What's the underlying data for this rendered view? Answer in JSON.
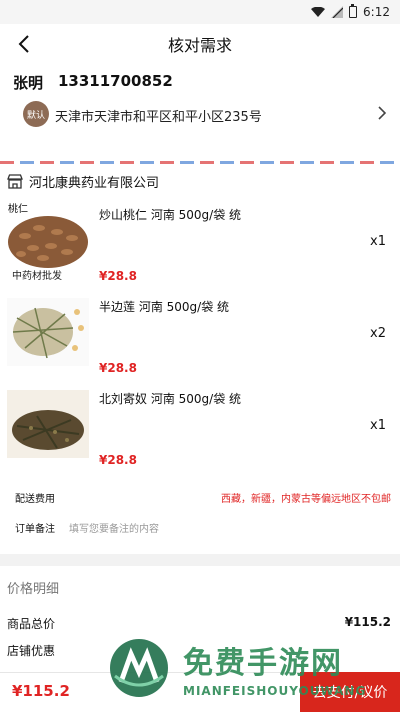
{
  "status_bar": {
    "time": "6:12"
  },
  "nav": {
    "title": "核对需求"
  },
  "address": {
    "name": "张明",
    "phone": "13311700852",
    "badge": "默认",
    "text": "天津市天津市和平区和平小区235号"
  },
  "store": {
    "name": "河北康典药业有限公司",
    "items": [
      {
        "title": "炒山桃仁 河南 500g/袋 统",
        "price": "¥28.8",
        "qty": "x1",
        "tag": "桃仁",
        "thumb_caption": "中药材批发"
      },
      {
        "title": "半边莲 河南 500g/袋 统",
        "price": "¥28.8",
        "qty": "x2"
      },
      {
        "title": "北刘寄奴 河南 500g/袋 统",
        "price": "¥28.8",
        "qty": "x1"
      }
    ],
    "shipping_label": "配送费用",
    "shipping_note": "西藏，新疆，内蒙古等偏远地区不包邮",
    "remark_label": "订单备注",
    "remark_placeholder": "填写您要备注的内容"
  },
  "price_detail": {
    "header": "价格明细",
    "goods_total_label": "商品总价",
    "goods_total_value": "¥115.2",
    "discount_label": "店铺优惠"
  },
  "bottom": {
    "total": "¥115.2",
    "pay_button": "去支付/议价"
  },
  "watermark": {
    "text_cn": "免费手游网",
    "text_en": "MIANFEISHOUYOUWANG"
  },
  "colors": {
    "price_red": "#e02424",
    "pay_button": "#d8261c",
    "badge": "#8d6b55"
  }
}
